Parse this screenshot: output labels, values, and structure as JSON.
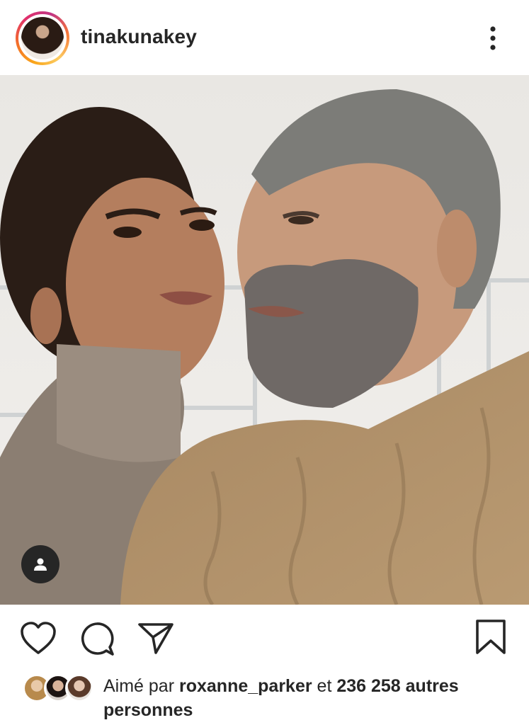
{
  "post": {
    "username": "tinakunakey",
    "more_icon": "more-vertical-icon"
  },
  "actions": {
    "like_icon": "heart-icon",
    "comment_icon": "comment-icon",
    "share_icon": "send-icon",
    "save_icon": "bookmark-icon",
    "tag_icon": "user-tag-icon"
  },
  "likes": {
    "prefix": "Aimé par ",
    "first_liker": "roxanne_parker",
    "connector": " et ",
    "count_text": "236 258 autres personnes"
  },
  "colors": {
    "text": "#262626",
    "ring_start": "#f9a51a",
    "ring_end": "#e1306c",
    "background": "#ffffff"
  }
}
